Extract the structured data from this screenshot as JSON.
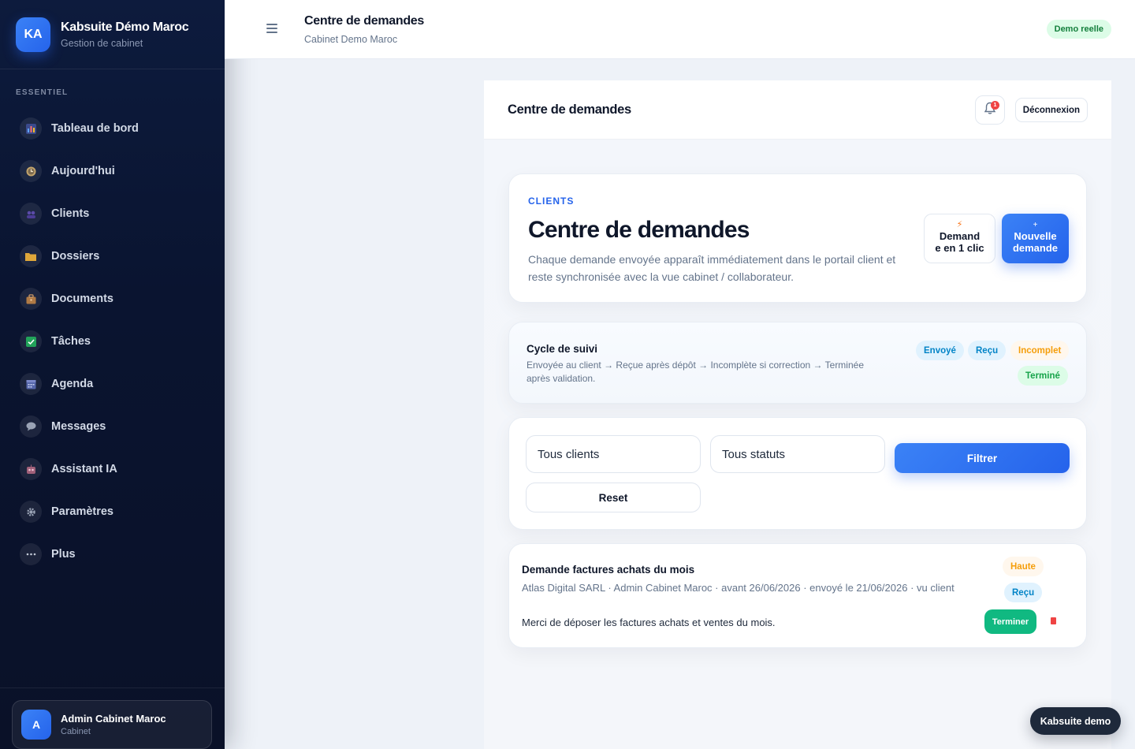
{
  "brand": {
    "initials": "KA",
    "name": "Kabsuite Démo Maroc",
    "subtitle": "Gestion de cabinet"
  },
  "sidebar": {
    "section_label": "ESSENTIEL",
    "items": [
      {
        "label": "Tableau de bord",
        "icon": "bar-chart-icon"
      },
      {
        "label": "Aujourd'hui",
        "icon": "clock-icon"
      },
      {
        "label": "Clients",
        "icon": "users-icon"
      },
      {
        "label": "Dossiers",
        "icon": "folder-icon"
      },
      {
        "label": "Documents",
        "icon": "briefcase-icon"
      },
      {
        "label": "Tâches",
        "icon": "check-icon"
      },
      {
        "label": "Agenda",
        "icon": "calendar-icon"
      },
      {
        "label": "Messages",
        "icon": "chat-icon"
      },
      {
        "label": "Assistant IA",
        "icon": "robot-icon"
      },
      {
        "label": "Paramètres",
        "icon": "gear-icon"
      },
      {
        "label": "Plus",
        "icon": "more-icon"
      }
    ],
    "user": {
      "initial": "A",
      "name": "Admin Cabinet Maroc",
      "role": "Cabinet"
    }
  },
  "topbar": {
    "title": "Centre de demandes",
    "subtitle": "Cabinet Demo Maroc",
    "badge": "Demo reelle"
  },
  "content": {
    "header_title": "Centre de demandes",
    "notification_count": "1",
    "logout_label": "Déconnexion"
  },
  "hero": {
    "kicker": "CLIENTS",
    "title": "Centre de demandes",
    "description": "Chaque demande envoyée apparaît immédiatement dans le portail client et reste synchronisée avec la vue cabinet / collaborateur.",
    "quick_icon": "⚡",
    "quick_label_1": "Demand",
    "quick_label_2": "e en 1 clic",
    "new_icon": "+",
    "new_label_1": "Nouvelle",
    "new_label_2": "demande"
  },
  "cycle": {
    "title": "Cycle de suivi",
    "description": "Envoyée au client → Reçue après dépôt → Incomplète si correction → Terminée après validation.",
    "statuses": {
      "sent": "Envoyé",
      "received": "Reçu",
      "incomplete": "Incomplet",
      "done": "Terminé"
    }
  },
  "filters": {
    "client_select": "Tous clients",
    "status_select": "Tous statuts",
    "filter_label": "Filtrer",
    "reset_label": "Reset"
  },
  "request": {
    "title": "Demande factures achats du mois",
    "meta": "Atlas Digital SARL · Admin Cabinet Maroc · avant 26/06/2026 · envoyé le 21/06/2026 · vu client",
    "message": "Merci de déposer les factures achats et ventes du mois.",
    "priority": "Haute",
    "status": "Reçu",
    "terminate_label": "Terminer"
  },
  "floating_label": "Kabsuite demo",
  "colors": {
    "accent": "#2563eb",
    "sidebar_bg": "#0a1430",
    "success": "#10b981",
    "warning": "#f59e0b",
    "danger": "#ef4444"
  }
}
